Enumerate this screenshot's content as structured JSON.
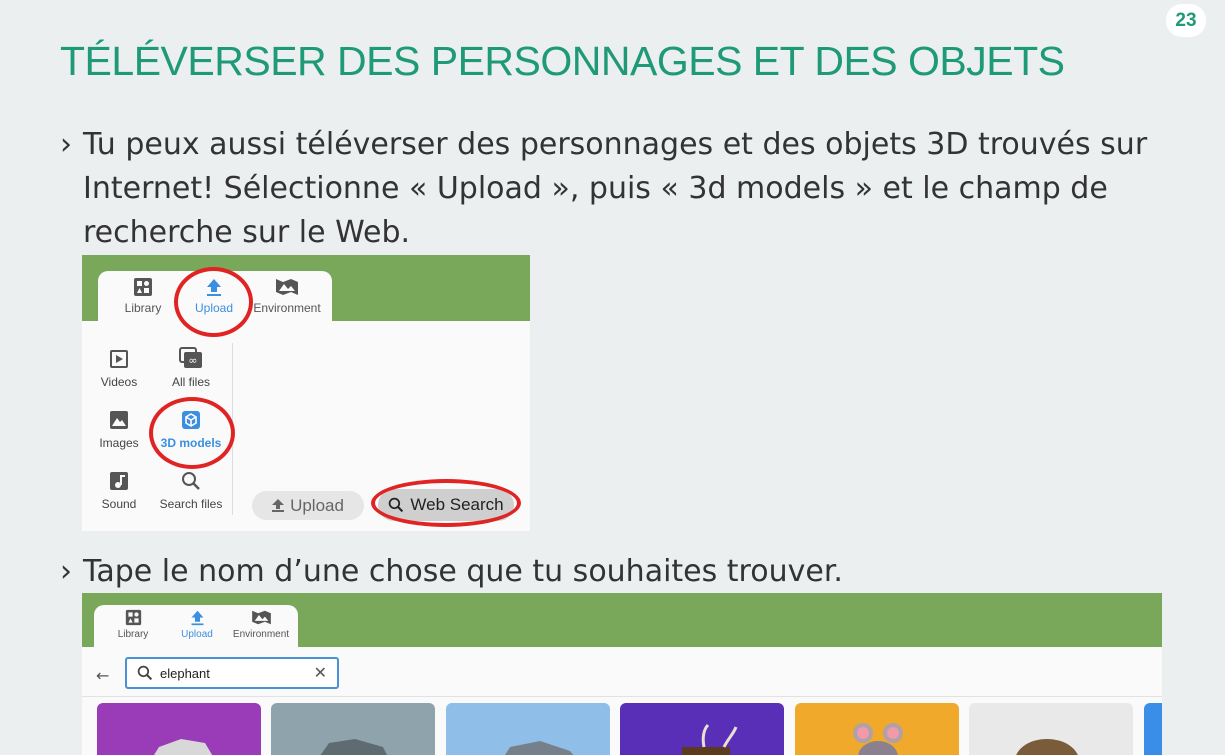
{
  "page_number": "23",
  "title": "TÉLÉVERSER DES PERSONNAGES ET DES OBJETS",
  "bullet_mark": "›",
  "bullets": [
    "Tu peux aussi téléverser des personnages et des objets 3D trouvés sur Internet! Sélectionne « Upload », puis « 3d models » et le champ de recherche sur le Web.",
    "Tape le nom d’une chose que tu souhaites trouver."
  ],
  "screenshot1": {
    "tabs": [
      {
        "label": "Library",
        "icon": "library-icon"
      },
      {
        "label": "Upload",
        "icon": "upload-icon",
        "active": true
      },
      {
        "label": "Environment",
        "icon": "environment-icon"
      }
    ],
    "categories": [
      {
        "label": "Videos",
        "icon": "video-icon"
      },
      {
        "label": "All files",
        "icon": "all-files-icon"
      },
      {
        "label": "Images",
        "icon": "image-icon"
      },
      {
        "label": "3D models",
        "icon": "cube-icon",
        "active": true
      },
      {
        "label": "Sound",
        "icon": "music-note-icon"
      },
      {
        "label": "Search files",
        "icon": "search-icon"
      }
    ],
    "upload_button": "Upload",
    "web_search_button": "Web Search"
  },
  "screenshot2": {
    "tabs": [
      {
        "label": "Library",
        "icon": "library-icon"
      },
      {
        "label": "Upload",
        "icon": "upload-icon",
        "active": true
      },
      {
        "label": "Environment",
        "icon": "environment-icon"
      }
    ],
    "search_value": "elephant",
    "result_colors": [
      "#9a3bb8",
      "#8fa3ad",
      "#8fbfe8",
      "#5a2fb8",
      "#f0a92a",
      "#e9e9e9",
      "#3a8ee8"
    ]
  },
  "colors": {
    "title": "#1f9a78",
    "green_bar": "#79a85a",
    "accent_blue": "#3b8fe0",
    "highlight_red": "#e02424"
  }
}
